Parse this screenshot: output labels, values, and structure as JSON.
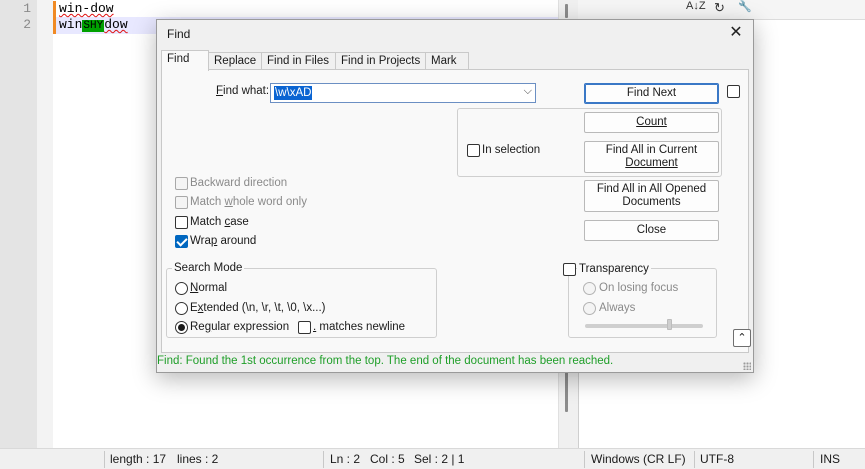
{
  "editor": {
    "lines": [
      {
        "number": "1",
        "text": "win-dow"
      },
      {
        "number": "2",
        "prefix": "win",
        "shy_glyph": "SHY",
        "suffix": "dow"
      }
    ]
  },
  "right_toolbar": {
    "icons": [
      "sort-az-icon",
      "refresh-icon",
      "wrench-icon"
    ],
    "sort_glyph": "A↓Z",
    "refresh_glyph": "↻",
    "wrench_glyph": "🔧"
  },
  "statusbar": {
    "length": "length : 17",
    "lines": "lines : 2",
    "ln": "Ln : 2",
    "col": "Col : 5",
    "sel": "Sel : 2 | 1",
    "eol": "Windows (CR LF)",
    "encoding": "UTF-8",
    "mode": "INS"
  },
  "dialog": {
    "title": "Find",
    "close_glyph": "✕",
    "tabs": [
      "Find",
      "Replace",
      "Find in Files",
      "Find in Projects",
      "Mark"
    ],
    "find_what_label_u": "F",
    "find_what_label_rest": "ind what:",
    "find_what_value": "\\w\\xAD",
    "combo_arrow": "⌵",
    "buttons": {
      "find_next": "Find Next",
      "count": "Count",
      "find_all_current_1": "Find All in Current",
      "find_all_current_2": "Document",
      "find_all_opened_1": "Find All in All Opened",
      "find_all_opened_2": "Documents",
      "close": "Close"
    },
    "in_selection": "In selection",
    "options": {
      "backward": "Backward direction",
      "match_whole_pre": "Match ",
      "match_whole_u": "w",
      "match_whole_post": "hole word only",
      "match_case_pre": "Match ",
      "match_case_u": "c",
      "match_case_post": "ase",
      "wrap_pre": "Wra",
      "wrap_u": "p",
      "wrap_post": " around"
    },
    "search_mode": {
      "title": "Search Mode",
      "normal_u": "N",
      "normal_rest": "ormal",
      "extended_pre": "E",
      "extended_u": "x",
      "extended_post": "tended (\\n, \\r, \\t, \\0, \\x...)",
      "regex_pre": "Re",
      "regex_u": "g",
      "regex_post": "ular expression",
      "dot_matches_u": ".",
      "dot_matches_rest": " matches newline",
      "selected": "regex"
    },
    "transparency": {
      "title": "Transparency",
      "on_losing_focus": "On losing focus",
      "always": "Always",
      "slider_fraction": 0.72
    },
    "collapse_glyph": "⌃",
    "status_message": "Find: Found the 1st occurrence from the top. The end of the document has been reached.",
    "status_color": "#1e9e28"
  }
}
